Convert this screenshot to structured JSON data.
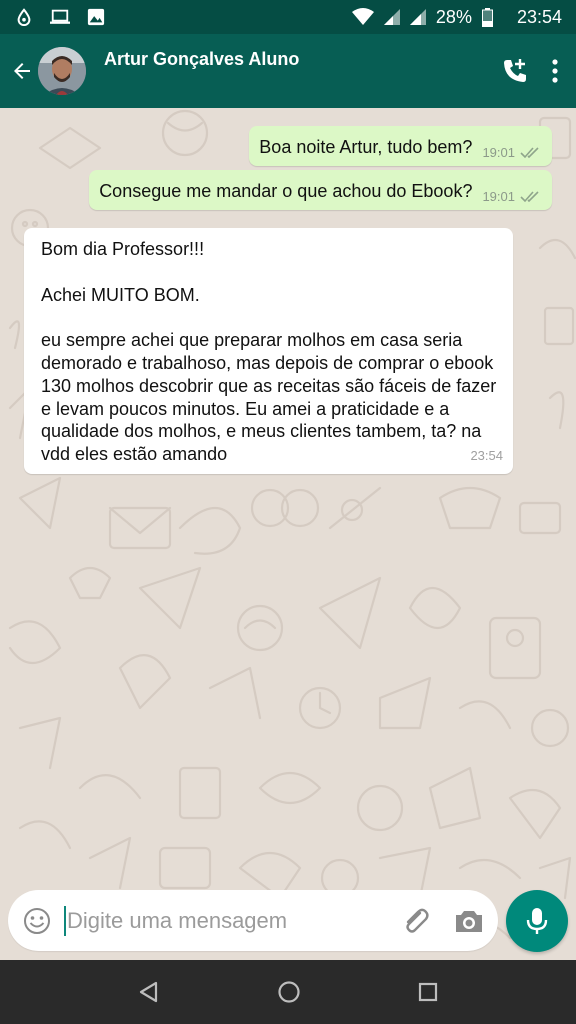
{
  "status_bar": {
    "battery": "28%",
    "time": "23:54"
  },
  "header": {
    "contact_name": "Artur Gonçalves Aluno"
  },
  "messages": [
    {
      "direction": "outgoing",
      "text": "Boa noite Artur, tudo bem?",
      "time": "19:01",
      "status": "read"
    },
    {
      "direction": "outgoing",
      "text": "Consegue me mandar o que achou do Ebook?",
      "time": "19:01",
      "status": "read"
    },
    {
      "direction": "incoming",
      "paragraphs": [
        "Bom dia Professor!!!",
        "Achei MUITO BOM.",
        "eu sempre achei que preparar molhos em casa seria demorado e trabalhoso, mas depois de comprar o ebook 130 molhos descobrir que as receitas são fáceis de fazer e levam poucos minutos. Eu amei a praticidade e a qualidade dos molhos, e meus clientes tambem, ta? na vdd eles estão amando"
      ],
      "time": "23:54"
    }
  ],
  "composer": {
    "placeholder": "Digite uma mensagem"
  },
  "colors": {
    "status_bar": "#054d44",
    "app_bar": "#075e54",
    "outgoing_bubble": "#dcf8c6",
    "chat_background": "#e5ddd5",
    "accent": "#00897b"
  }
}
